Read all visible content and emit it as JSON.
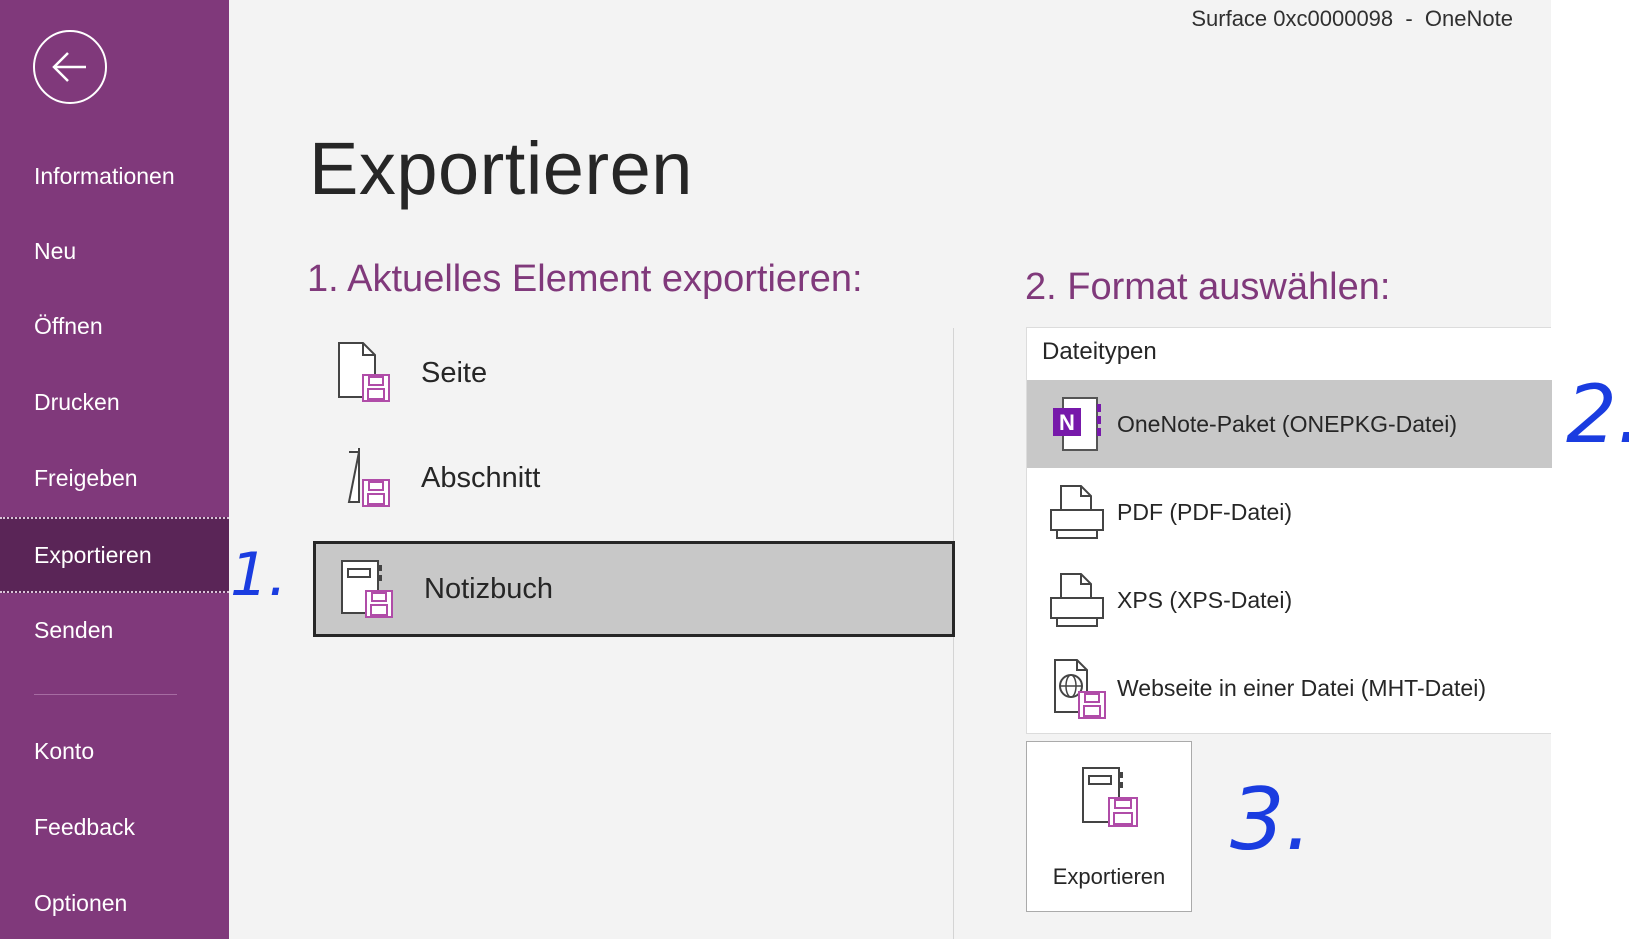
{
  "window": {
    "title": "Surface 0xc0000098  -  OneNote"
  },
  "sidebar": {
    "items": [
      {
        "label": "Informationen"
      },
      {
        "label": "Neu"
      },
      {
        "label": "Öffnen"
      },
      {
        "label": "Drucken"
      },
      {
        "label": "Freigeben"
      },
      {
        "label": "Exportieren",
        "selected": true
      },
      {
        "label": "Senden"
      },
      {
        "label": "Konto"
      },
      {
        "label": "Feedback"
      },
      {
        "label": "Optionen"
      }
    ]
  },
  "main": {
    "title": "Exportieren",
    "scope": {
      "heading": "1. Aktuelles Element exportieren:",
      "items": [
        {
          "label": "Seite",
          "icon": "page-save-icon"
        },
        {
          "label": "Abschnitt",
          "icon": "section-save-icon"
        },
        {
          "label": "Notizbuch",
          "icon": "notebook-save-icon",
          "selected": true
        }
      ]
    },
    "format": {
      "heading": "2. Format auswählen:",
      "list_header": "Dateitypen",
      "items": [
        {
          "label": "OneNote-Paket (ONEPKG-Datei)",
          "icon": "onenote-package-icon",
          "selected": true
        },
        {
          "label": "PDF (PDF-Datei)",
          "icon": "printer-icon"
        },
        {
          "label": "XPS (XPS-Datei)",
          "icon": "printer-icon"
        },
        {
          "label": "Webseite in einer Datei (MHT-Datei)",
          "icon": "web-page-save-icon"
        }
      ]
    },
    "export_button": {
      "label": "Exportieren",
      "icon": "notebook-save-icon"
    }
  },
  "annotations": {
    "step1": "1.",
    "step2": "2.",
    "step3": "3."
  },
  "colors": {
    "accent": "#80397b",
    "selected_nav": "#5a2557",
    "annotation": "#1a3ce0",
    "selection_gray": "#c8c8c8"
  }
}
